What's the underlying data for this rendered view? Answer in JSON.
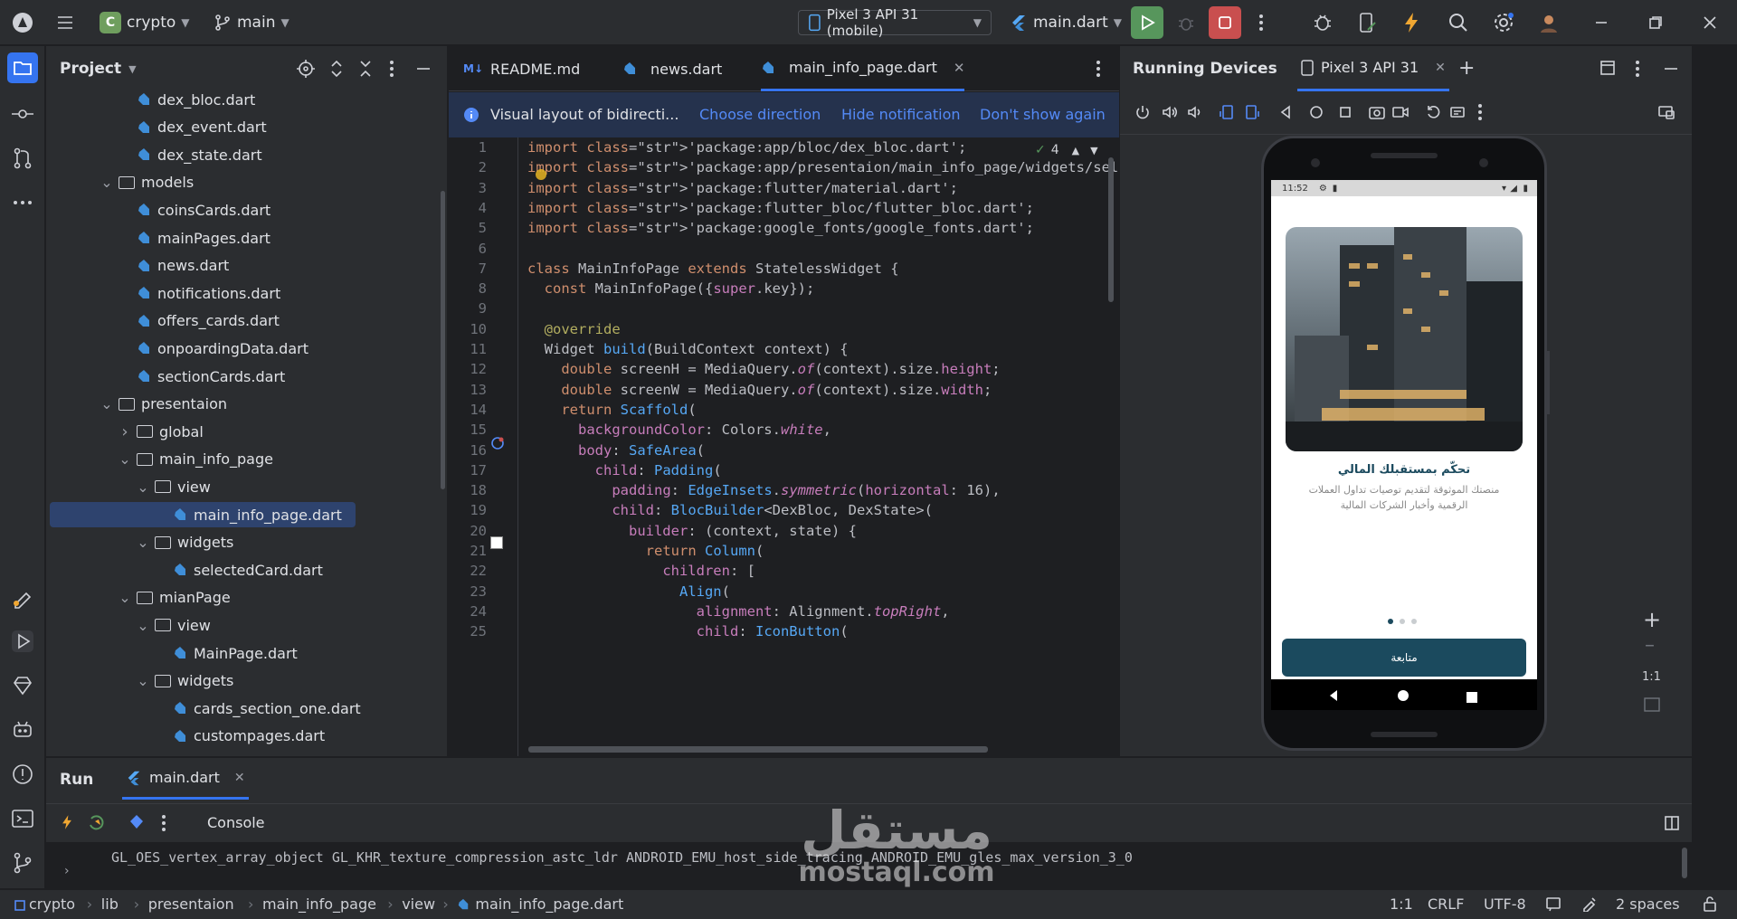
{
  "titlebar": {
    "project_initial": "C",
    "project_name": "crypto",
    "branch": "main",
    "device": "Pixel 3 API 31 (mobile)",
    "run_config": "main.dart"
  },
  "project_panel": {
    "title": "Project",
    "tree": [
      {
        "label": "dex_bloc.dart",
        "kind": "dart",
        "depth": 3
      },
      {
        "label": "dex_event.dart",
        "kind": "dart",
        "depth": 3
      },
      {
        "label": "dex_state.dart",
        "kind": "dart",
        "depth": 3
      },
      {
        "label": "models",
        "kind": "folder-open",
        "depth": 2
      },
      {
        "label": "coinsCards.dart",
        "kind": "dart",
        "depth": 3
      },
      {
        "label": "mainPages.dart",
        "kind": "dart",
        "depth": 3
      },
      {
        "label": "news.dart",
        "kind": "dart",
        "depth": 3
      },
      {
        "label": "notifications.dart",
        "kind": "dart",
        "depth": 3
      },
      {
        "label": "offers_cards.dart",
        "kind": "dart",
        "depth": 3
      },
      {
        "label": "onpoardingData.dart",
        "kind": "dart",
        "depth": 3
      },
      {
        "label": "sectionCards.dart",
        "kind": "dart",
        "depth": 3
      },
      {
        "label": "presentaion",
        "kind": "folder-open",
        "depth": 2
      },
      {
        "label": "global",
        "kind": "folder-closed",
        "depth": 3
      },
      {
        "label": "main_info_page",
        "kind": "folder-open",
        "depth": 3
      },
      {
        "label": "view",
        "kind": "folder-open",
        "depth": 4
      },
      {
        "label": "main_info_page.dart",
        "kind": "dart",
        "depth": 5,
        "selected": true
      },
      {
        "label": "widgets",
        "kind": "folder-open",
        "depth": 4
      },
      {
        "label": "selectedCard.dart",
        "kind": "dart",
        "depth": 5
      },
      {
        "label": "mianPage",
        "kind": "folder-open",
        "depth": 3
      },
      {
        "label": "view",
        "kind": "folder-open",
        "depth": 4
      },
      {
        "label": "MainPage.dart",
        "kind": "dart",
        "depth": 5
      },
      {
        "label": "widgets",
        "kind": "folder-open",
        "depth": 4
      },
      {
        "label": "cards_section_one.dart",
        "kind": "dart",
        "depth": 5
      },
      {
        "label": "custompages.dart",
        "kind": "dart",
        "depth": 5
      }
    ]
  },
  "editor": {
    "tabs": [
      {
        "label": "README.md",
        "icon": "markdown-icon",
        "active": false
      },
      {
        "label": "news.dart",
        "icon": "dart-icon",
        "active": false
      },
      {
        "label": "main_info_page.dart",
        "icon": "dart-icon",
        "active": true
      }
    ],
    "notification": {
      "text": "Visual layout of bidirecti...",
      "choose": "Choose direction",
      "hide": "Hide notification",
      "dont_show": "Don't show again"
    },
    "inspection_count": "4",
    "lines": [
      "import 'package:app/bloc/dex_bloc.dart';",
      "import 'package:app/presentaion/main_info_page/widgets/selectedCa",
      "import 'package:flutter/material.dart';",
      "import 'package:flutter_bloc/flutter_bloc.dart';",
      "import 'package:google_fonts/google_fonts.dart';",
      "",
      "class MainInfoPage extends StatelessWidget {",
      "  const MainInfoPage({super.key});",
      "",
      "  @override",
      "  Widget build(BuildContext context) {",
      "    double screenH = MediaQuery.of(context).size.height;",
      "    double screenW = MediaQuery.of(context).size.width;",
      "    return Scaffold(",
      "      backgroundColor: Colors.white,",
      "      body: SafeArea(",
      "        child: Padding(",
      "          padding: EdgeInsets.symmetric(horizontal: 16),",
      "          child: BlocBuilder<DexBloc, DexState>(",
      "            builder: (context, state) {",
      "              return Column(",
      "                children: [",
      "                  Align(",
      "                    alignment: Alignment.topRight,",
      "                    child: IconButton("
    ]
  },
  "devices": {
    "title": "Running Devices",
    "device_tab": "Pixel 3 API 31",
    "phone": {
      "time": "11:52",
      "headline": "تحكّم بمستقبلك المالي",
      "body_line1": "منصتك الموثوقة لتقديم توصيات تداول العملات",
      "body_line2": "الرقمية وأخبار الشركات المالية",
      "button": "متابعة",
      "page_index": 1,
      "page_count": 3
    },
    "zoom_label": "1:1"
  },
  "run_panel": {
    "tab_run": "Run",
    "tab_config": "main.dart",
    "console": "Console",
    "output": "GL_OES_vertex_array_object GL_KHR_texture_compression_astc_ldr ANDROID_EMU_host_side_tracing ANDROID_EMU_gles_max_version_3_0"
  },
  "watermark": {
    "arabic": "مستقل",
    "latin": "mostaql.com"
  },
  "statusbar": {
    "breadcrumb": [
      "crypto",
      "lib",
      "presentaion",
      "main_info_page",
      "view",
      "main_info_page.dart"
    ],
    "position": "1:1",
    "line_sep": "CRLF",
    "encoding": "UTF-8",
    "indent": "2 spaces"
  },
  "colors": {
    "accent": "#3574f0",
    "run": "#57965c",
    "stop": "#c94f4f",
    "phone_button": "#1b4a5e"
  }
}
